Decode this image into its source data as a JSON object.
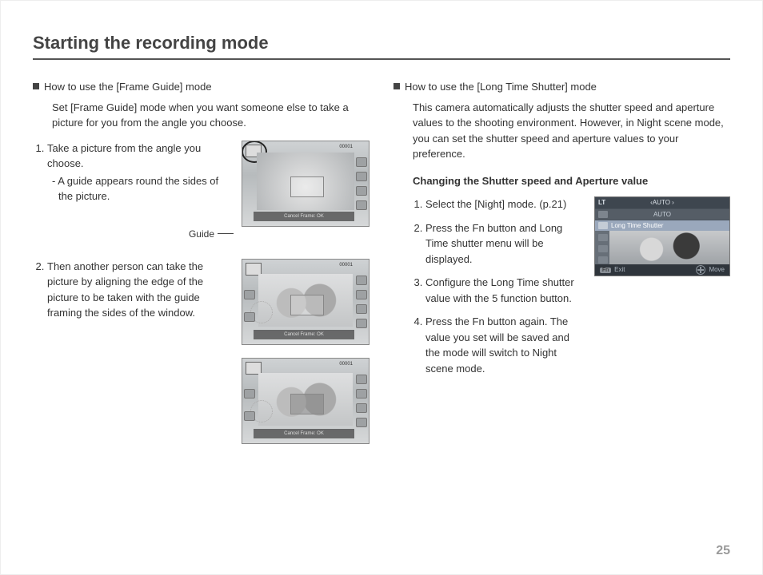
{
  "title": "Starting the recording mode",
  "page_number": "25",
  "left": {
    "heading": "How to use the [Frame Guide] mode",
    "intro": "Set [Frame Guide] mode when you want someone else to take a picture for you from the angle you choose.",
    "step1": "Take a picture from the angle you choose.",
    "step1_note": "- A guide appears round the sides of the picture.",
    "guide_label": "Guide",
    "step2": "Then another person can take the picture by aligning the edge of the picture to be taken with the guide framing the sides of the window.",
    "lcd_counter1": "00001",
    "lcd_counter2": "00001",
    "lcd_counter3": "00001",
    "lcd_footer": "Cancel Frame: OK"
  },
  "right": {
    "heading": "How to use the [Long Time Shutter] mode",
    "intro": "This camera automatically adjusts the shutter speed and aperture values to the shooting environment. However, in Night scene mode, you can set the shutter speed and aperture values to your preference.",
    "subheading": "Changing the Shutter speed and Aperture value",
    "step1": "Select the [Night] mode. (p.21)",
    "step2": "Press the Fn button and Long Time shutter menu will be displayed.",
    "step3": "Configure the Long Time shutter value with the 5 function button.",
    "step4": "Press the Fn button again. The value you set will be saved and the mode will switch to Night scene mode.",
    "menu": {
      "lt": "LT",
      "auto_header": "AUTO",
      "auto_row": "AUTO",
      "selected": "Long Time Shutter",
      "fn": "Fn",
      "exit": "Exit",
      "move": "Move"
    }
  }
}
